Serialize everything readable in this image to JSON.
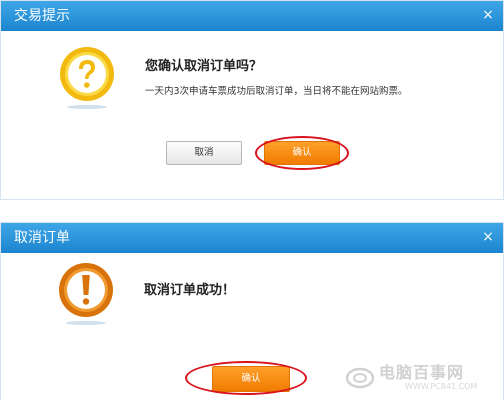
{
  "dialog1": {
    "title": "交易提示",
    "close": "×",
    "icon": "question-mark-icon",
    "heading": "您确认取消订单吗？",
    "message": "一天内3次申请车票成功后取消订单，当日将不能在网站购票。",
    "cancel_label": "取消",
    "confirm_label": "确认"
  },
  "dialog2": {
    "title": "取消订单",
    "close": "×",
    "icon": "exclamation-mark-icon",
    "heading": "取消订单成功！",
    "confirm_label": "确认"
  },
  "watermark": {
    "title": "电脑百事网",
    "url": "WWW.PC841.COM"
  },
  "colors": {
    "titlebar": "#2a93db",
    "confirm": "#f58a0b",
    "highlight_ring": "#d9141d",
    "question_icon": "#f5c518",
    "exclamation_icon": "#e07b10"
  }
}
